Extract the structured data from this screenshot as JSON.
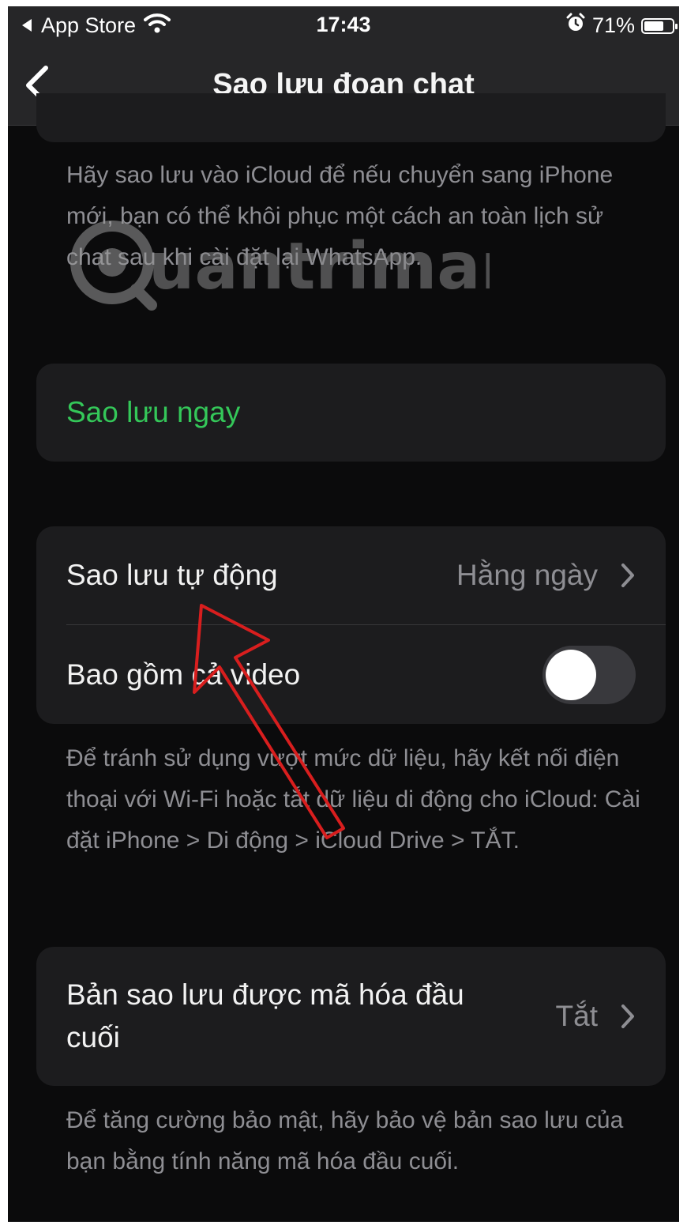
{
  "status_bar": {
    "back_app": "App Store",
    "time": "17:43",
    "battery": "71%",
    "battery_level": 0.71
  },
  "nav": {
    "title": "Sao lưu đoạn chat"
  },
  "intro_text": "Hãy sao lưu vào iCloud để nếu chuyển sang iPhone mới, bạn có thể khôi phục một cách an toàn lịch sử chat sau khi cài đặt lại WhatsApp.",
  "backup_now": {
    "label": "Sao lưu ngay",
    "color": "#34c759"
  },
  "auto_backup": {
    "label": "Sao lưu tự động",
    "value": "Hằng ngày"
  },
  "include_video": {
    "label": "Bao gồm cả video",
    "enabled": false
  },
  "data_usage_note": "Để tránh sử dụng vượt mức dữ liệu, hãy kết nối điện thoại với Wi-Fi hoặc tắt dữ liệu di động cho iCloud: Cài đặt iPhone > Di động > iCloud Drive > TẮT.",
  "e2e_backup": {
    "label": "Bản sao lưu được mã hóa đầu cuối",
    "value": "Tắt"
  },
  "e2e_note": "Để tăng cường bảo mật, hãy bảo vệ bản sao lưu của bạn bằng tính năng mã hóa đầu cuối.",
  "watermark": "uantrimang",
  "colors": {
    "background": "#0b0b0c",
    "card": "#1c1c1e",
    "secondary_text": "#8e8e93",
    "accent_green": "#34c759",
    "annotation_red": "#d81e1e"
  }
}
